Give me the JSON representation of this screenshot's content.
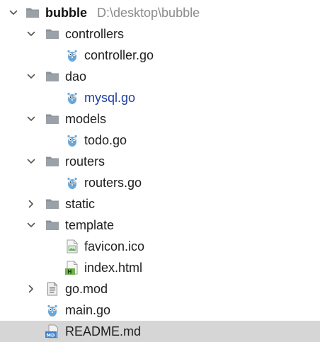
{
  "tree": {
    "root": {
      "name": "bubble",
      "path": "D:\\desktop\\bubble"
    },
    "items": [
      {
        "label": "controllers",
        "type": "folder",
        "expanded": true
      },
      {
        "label": "controller.go",
        "type": "go-file"
      },
      {
        "label": "dao",
        "type": "folder",
        "expanded": true
      },
      {
        "label": "mysql.go",
        "type": "go-file",
        "modified": true
      },
      {
        "label": "models",
        "type": "folder",
        "expanded": true
      },
      {
        "label": "todo.go",
        "type": "go-file"
      },
      {
        "label": "routers",
        "type": "folder",
        "expanded": true
      },
      {
        "label": "routers.go",
        "type": "go-file"
      },
      {
        "label": "static",
        "type": "folder",
        "expanded": false
      },
      {
        "label": "template",
        "type": "folder",
        "expanded": true
      },
      {
        "label": "favicon.ico",
        "type": "image-file"
      },
      {
        "label": "index.html",
        "type": "html-file"
      },
      {
        "label": "go.mod",
        "type": "mod-file",
        "expanded": false
      },
      {
        "label": "main.go",
        "type": "go-file"
      },
      {
        "label": "README.md",
        "type": "markdown-file",
        "selected": true
      }
    ]
  },
  "colors": {
    "folder": "#8a9199",
    "gopher": "#6aa7d8",
    "modified_text": "#1f3fa0",
    "selection": "#d6d6d6",
    "html_badge": "#6fb34a",
    "md_badge": "#3f82c8"
  }
}
